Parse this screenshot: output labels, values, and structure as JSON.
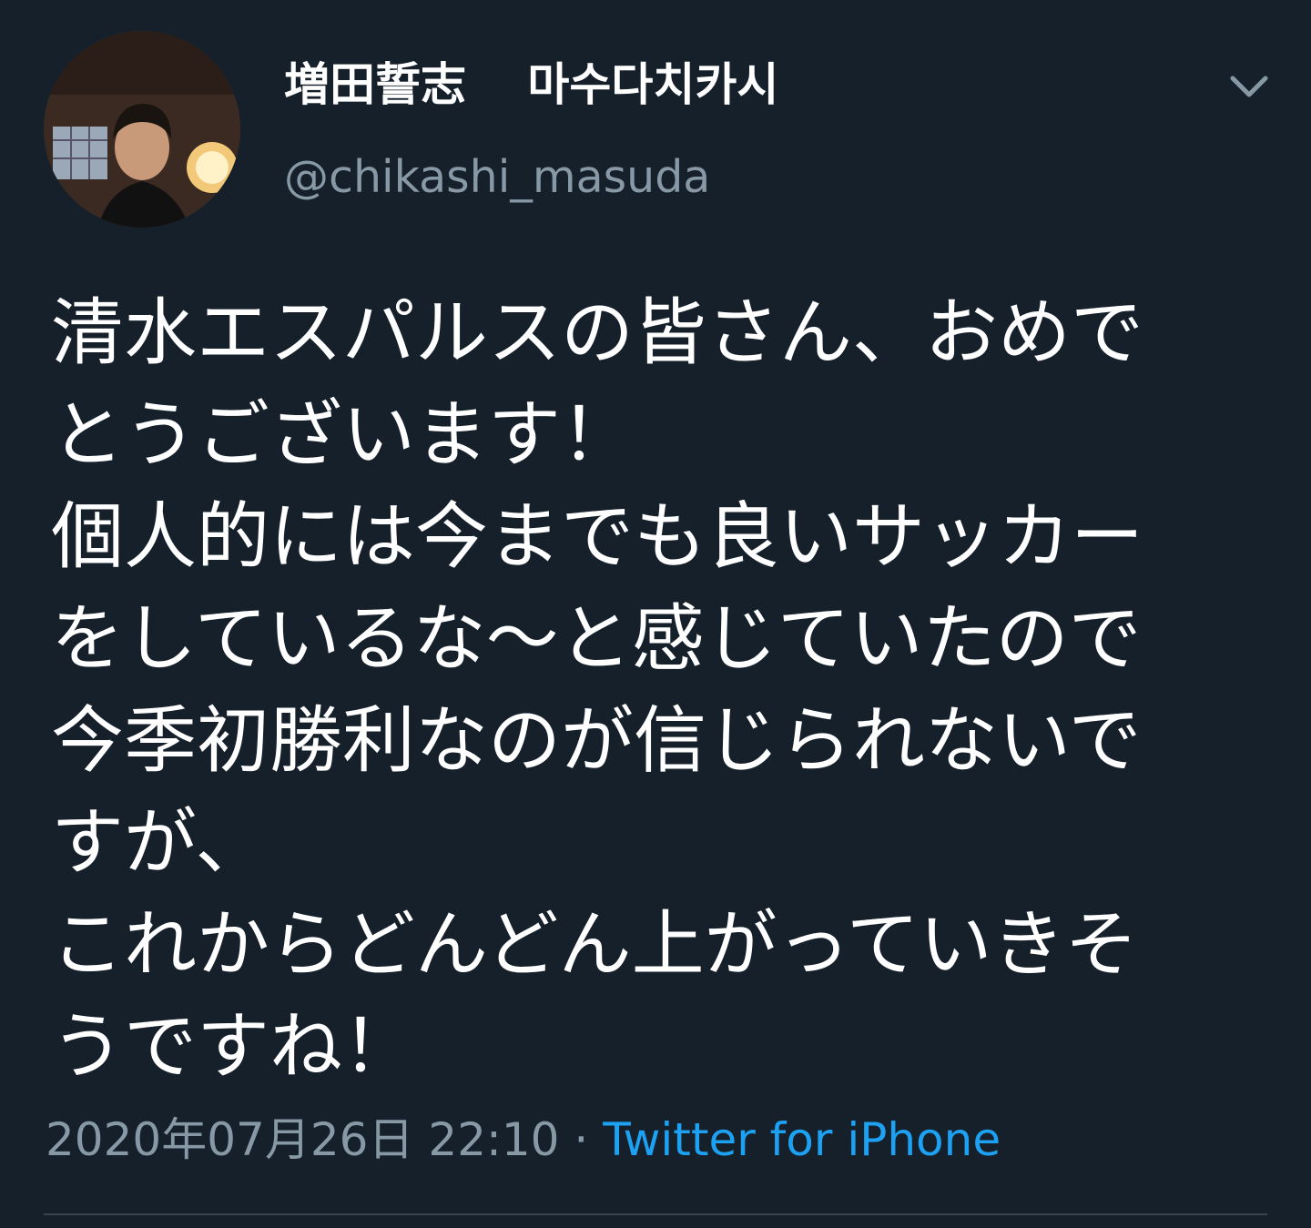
{
  "tweet": {
    "display_name": "増田誓志　 마수다치카시",
    "handle": "@chikashi_masuda",
    "text_lines": [
      "清水エスパルスの皆さん、おめで",
      "とうございます！",
      "個人的には今までも良いサッカー",
      "をしているな～と感じていたので",
      "今季初勝利なのが信じられないで",
      "すが、",
      "これからどんどん上がっていきそ",
      "うですね！"
    ],
    "timestamp": "2020年07月26日 22:10",
    "separator": "·",
    "source": "Twitter for iPhone"
  },
  "icons": {
    "menu": "chevron-down-icon",
    "avatar": "profile-photo"
  },
  "colors": {
    "background": "#15202b",
    "text": "#ffffff",
    "secondary": "#8899a6",
    "link": "#1da1f2",
    "divider": "#38444d"
  }
}
